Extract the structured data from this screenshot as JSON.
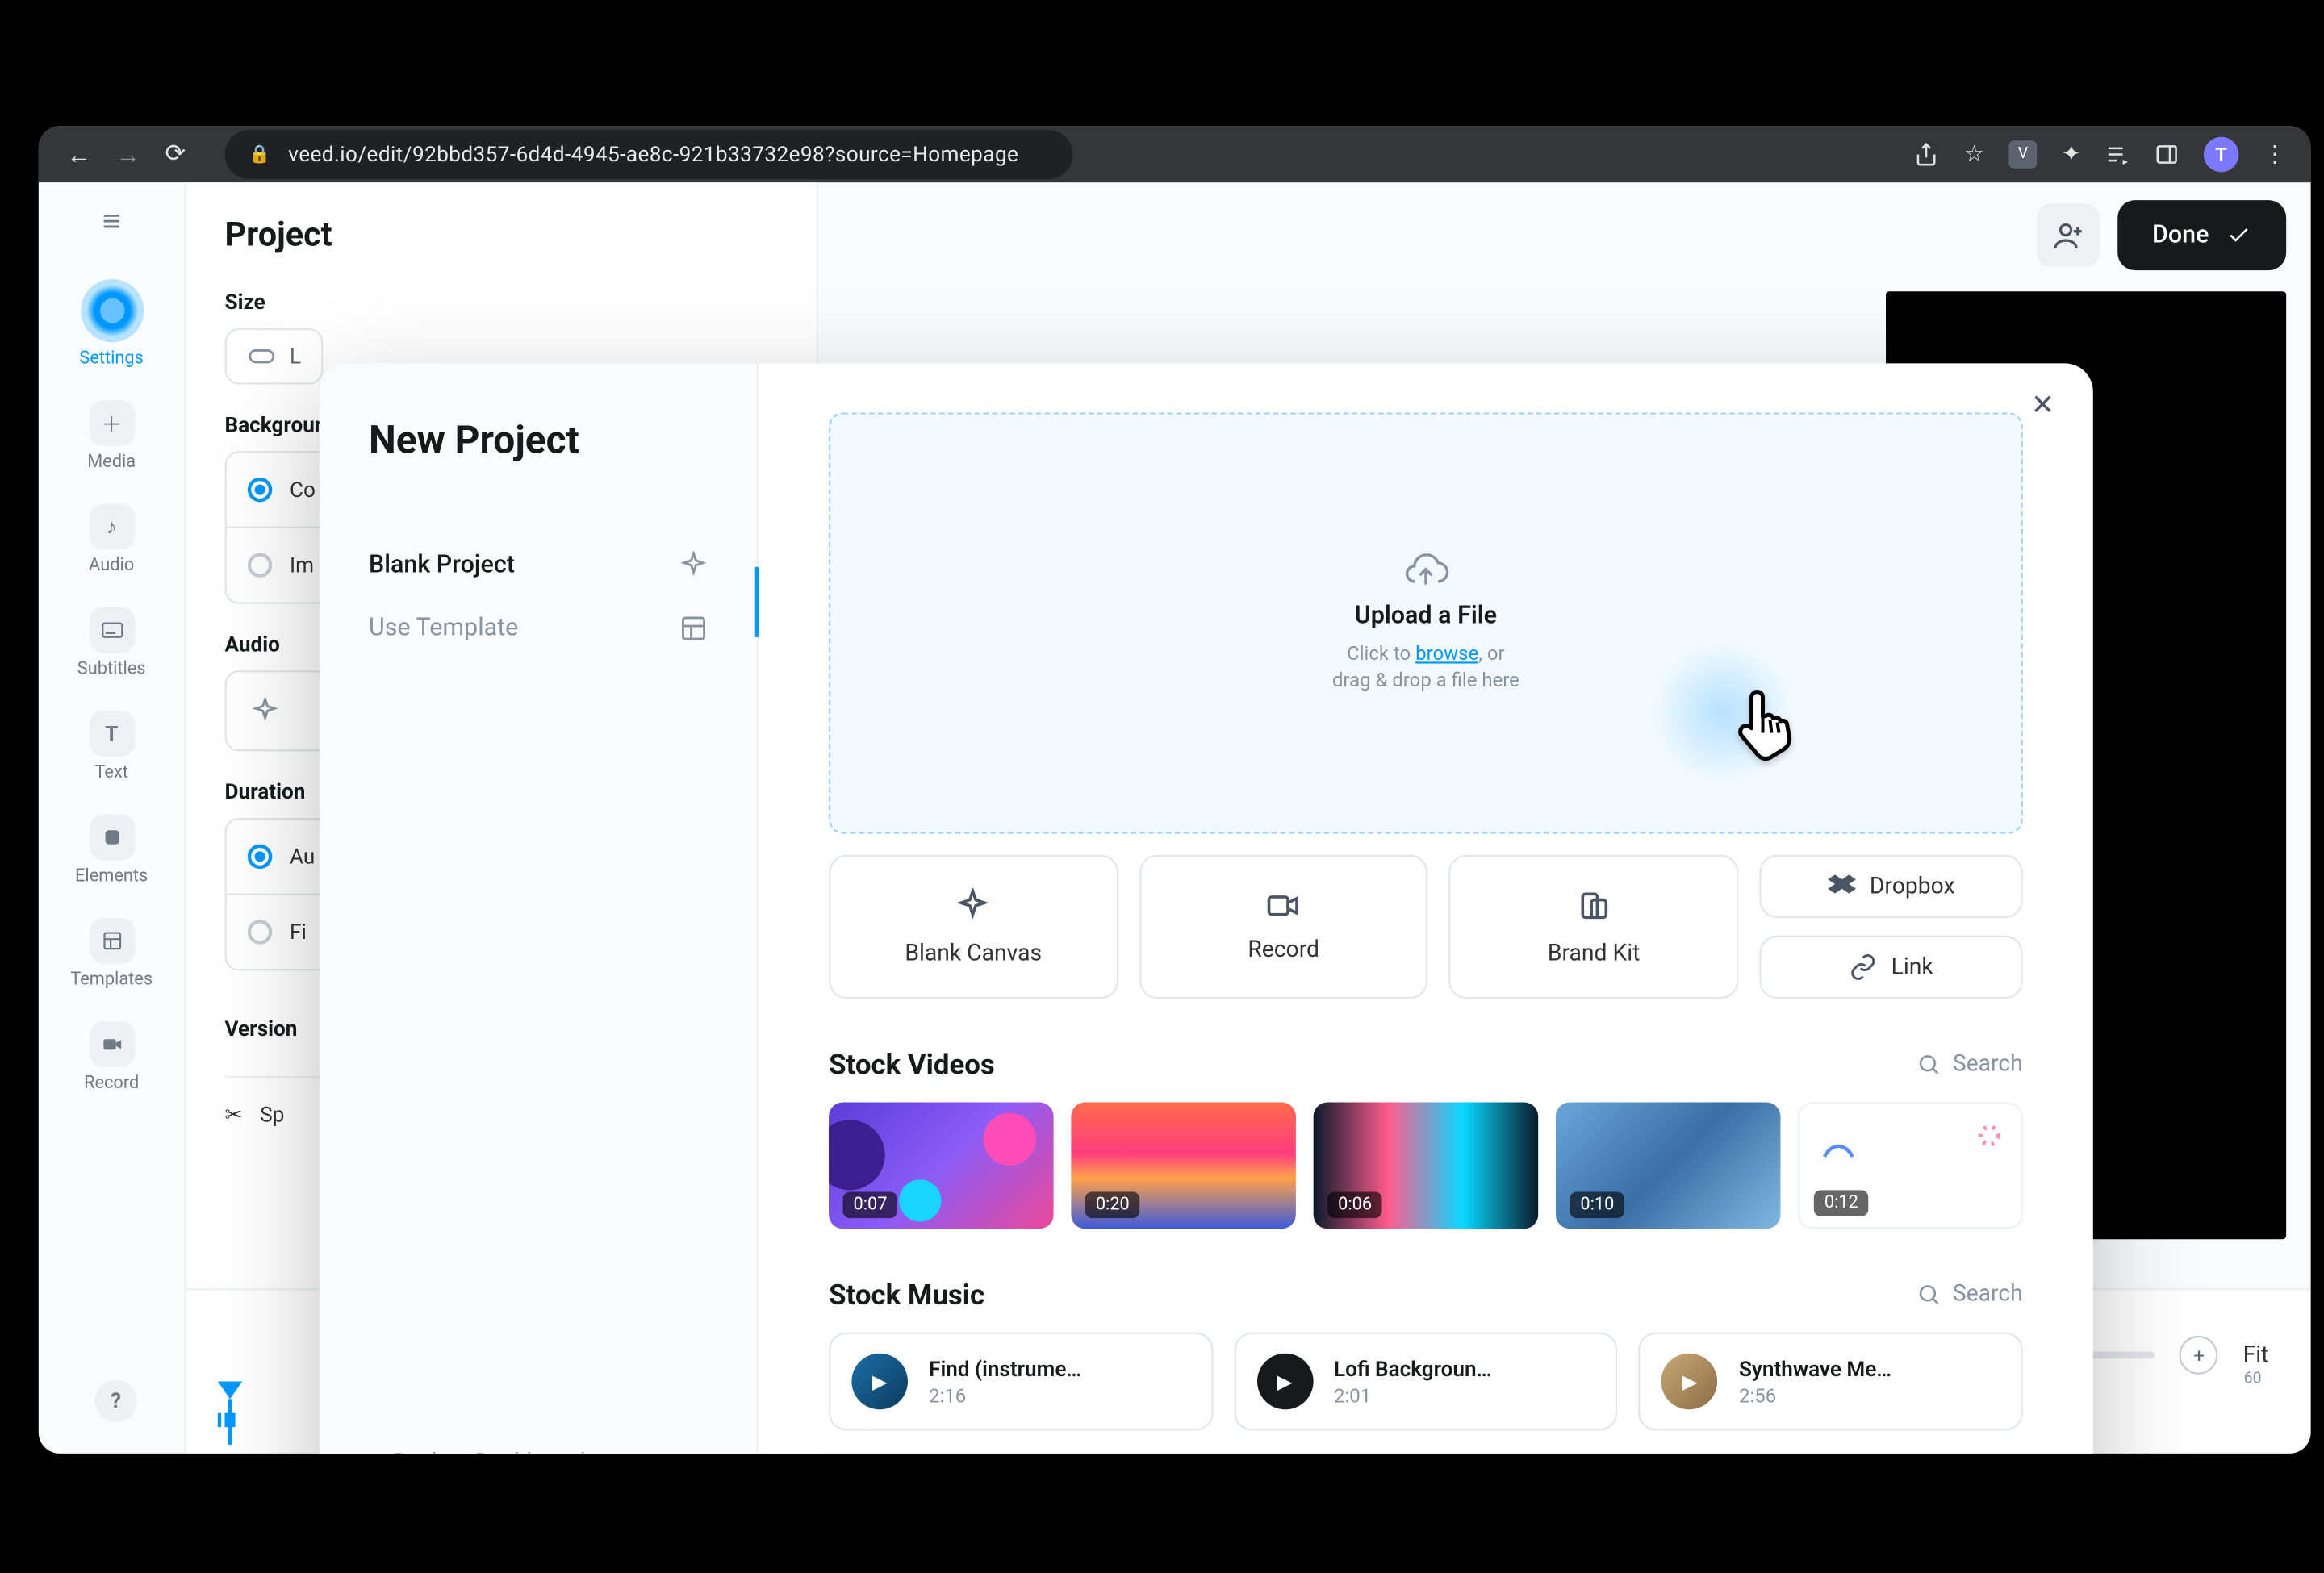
{
  "browser": {
    "url": "veed.io/edit/92bbd357-6d4d-4945-ae8c-921b33732e98?source=Homepage",
    "avatar_letter": "T",
    "ext_badge": "V"
  },
  "sidebar": {
    "items": [
      {
        "label": "Settings",
        "icon": "settings"
      },
      {
        "label": "Media",
        "icon": "plus"
      },
      {
        "label": "Audio",
        "icon": "note"
      },
      {
        "label": "Subtitles",
        "icon": "cc"
      },
      {
        "label": "Text",
        "icon": "text"
      },
      {
        "label": "Elements",
        "icon": "shape"
      },
      {
        "label": "Templates",
        "icon": "template"
      },
      {
        "label": "Record",
        "icon": "camera"
      }
    ]
  },
  "panel": {
    "title": "Project",
    "size_label": "Size",
    "size_value": "L",
    "bg_label": "Background",
    "bg_options": [
      "Co",
      "Im"
    ],
    "audio_label": "Audio",
    "duration_label": "Duration",
    "duration_options": [
      "Au",
      "Fi"
    ],
    "version_label": "Version",
    "split_label": "Sp"
  },
  "topbar": {
    "done_label": "Done"
  },
  "timeline": {
    "fit_label": "Fit",
    "ruler_end": "60"
  },
  "modal": {
    "title": "New Project",
    "left_items": [
      {
        "label": "Blank Project",
        "active": true
      },
      {
        "label": "Use Template",
        "active": false
      }
    ],
    "back_label": "Back to Dashboard",
    "dropzone": {
      "title": "Upload a File",
      "pre": "Click to ",
      "link": "browse",
      "post": ", or",
      "line2": "drag & drop a file here"
    },
    "actions": [
      {
        "label": "Blank Canvas"
      },
      {
        "label": "Record"
      },
      {
        "label": "Brand Kit"
      }
    ],
    "small_actions": [
      {
        "label": "Dropbox"
      },
      {
        "label": "Link"
      }
    ],
    "stock_videos": {
      "title": "Stock Videos",
      "search": "Search",
      "items": [
        {
          "duration": "0:07"
        },
        {
          "duration": "0:20"
        },
        {
          "duration": "0:06"
        },
        {
          "duration": "0:10"
        },
        {
          "duration": "0:12"
        }
      ]
    },
    "stock_music": {
      "title": "Stock Music",
      "search": "Search",
      "items": [
        {
          "title": "Find (instrume…",
          "duration": "2:16"
        },
        {
          "title": "Lofi Backgroun…",
          "duration": "2:01"
        },
        {
          "title": "Synthwave Me…",
          "duration": "2:56"
        }
      ]
    }
  }
}
